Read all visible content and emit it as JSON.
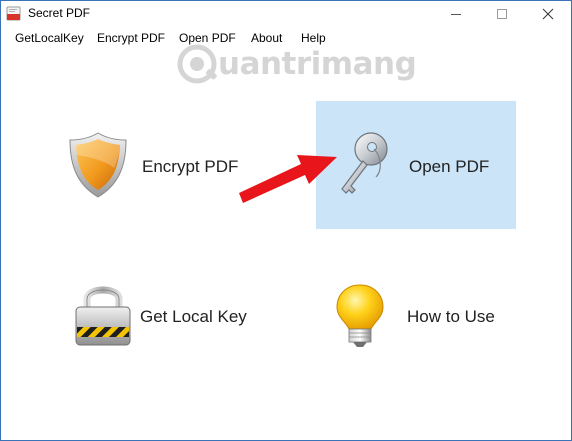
{
  "window": {
    "title": "Secret PDF",
    "min_icon": "minimize-icon",
    "max_icon": "maximize-icon",
    "close_icon": "close-icon"
  },
  "menu": {
    "items": [
      "GetLocalKey",
      "Encrypt PDF",
      "Open PDF",
      "About",
      "Help"
    ]
  },
  "watermark": {
    "text": "uantrimang"
  },
  "tiles": {
    "encrypt": {
      "label": "Encrypt PDF",
      "icon": "shield-icon"
    },
    "open": {
      "label": "Open PDF",
      "icon": "key-icon",
      "selected": true
    },
    "local_key": {
      "label": "Get Local Key",
      "icon": "padlock-icon"
    },
    "how_to": {
      "label": "How to Use",
      "icon": "lightbulb-icon"
    }
  },
  "colors": {
    "selected_tile_bg": "#cce4f7",
    "arrow": "#e8161b",
    "window_border": "#3b73b8"
  }
}
